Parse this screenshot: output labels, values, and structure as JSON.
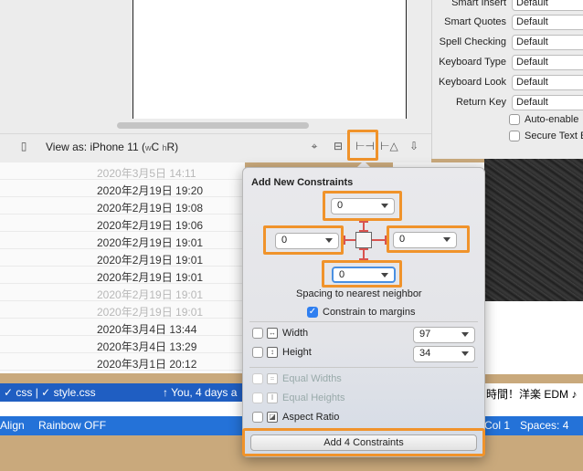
{
  "canvas": {
    "view_as_prefix": "View as: iPhone 11 (",
    "view_as_suffix": "C ",
    "view_as_end": "R)",
    "size_w": "w",
    "size_h": "h"
  },
  "inspector": {
    "rows": [
      {
        "label": "Smart Insert",
        "value": "Default"
      },
      {
        "label": "Smart Quotes",
        "value": "Default"
      },
      {
        "label": "Spell Checking",
        "value": "Default"
      },
      {
        "label": "Keyboard Type",
        "value": "Default"
      },
      {
        "label": "Keyboard Look",
        "value": "Default"
      },
      {
        "label": "Return Key",
        "value": "Default"
      }
    ],
    "checks": [
      "Auto-enable",
      "Secure Text E"
    ]
  },
  "file_list": [
    {
      "date": "2020年3月5日 14:11",
      "faded": true
    },
    {
      "date": "2020年2月19日 19:20",
      "faded": false
    },
    {
      "date": "2020年2月19日 19:08",
      "faded": false
    },
    {
      "date": "2020年2月19日 19:06",
      "faded": false
    },
    {
      "date": "2020年2月19日 19:01",
      "faded": false
    },
    {
      "date": "2020年2月19日 19:01",
      "faded": false
    },
    {
      "date": "2020年2月19日 19:01",
      "faded": false
    },
    {
      "date": "2020年2月19日 19:01",
      "faded": true
    },
    {
      "date": "2020年2月19日 19:01",
      "faded": true
    },
    {
      "date": "2020年3月4日 13:44",
      "faded": false
    },
    {
      "date": "2020年3月4日 13:29",
      "faded": false
    },
    {
      "date": "2020年3月1日 20:12",
      "faded": false
    }
  ],
  "statusbar": {
    "css": "✓ css | ✓ style.css",
    "git": "↑ You, 4 days a",
    "jp_text": "時間！洋楽 EDM ♪",
    "align": "Align",
    "rainbow": "Rainbow OFF",
    "col": "Col 1",
    "spaces": "Spaces: 4"
  },
  "popover": {
    "title": "Add New Constraints",
    "top": "0",
    "left": "0",
    "right": "0",
    "bottom": "0",
    "spacing_label": "Spacing to nearest neighbor",
    "constrain_margins": "Constrain to margins",
    "width_label": "Width",
    "width_value": "97",
    "height_label": "Height",
    "height_value": "34",
    "equal_widths": "Equal Widths",
    "equal_heights": "Equal Heights",
    "aspect_ratio": "Aspect Ratio",
    "add_button": "Add 4 Constraints"
  },
  "colors": {
    "highlight": "#f0932b",
    "status_blue": "#2472d8",
    "checkbox_blue": "#2f7ff0"
  }
}
